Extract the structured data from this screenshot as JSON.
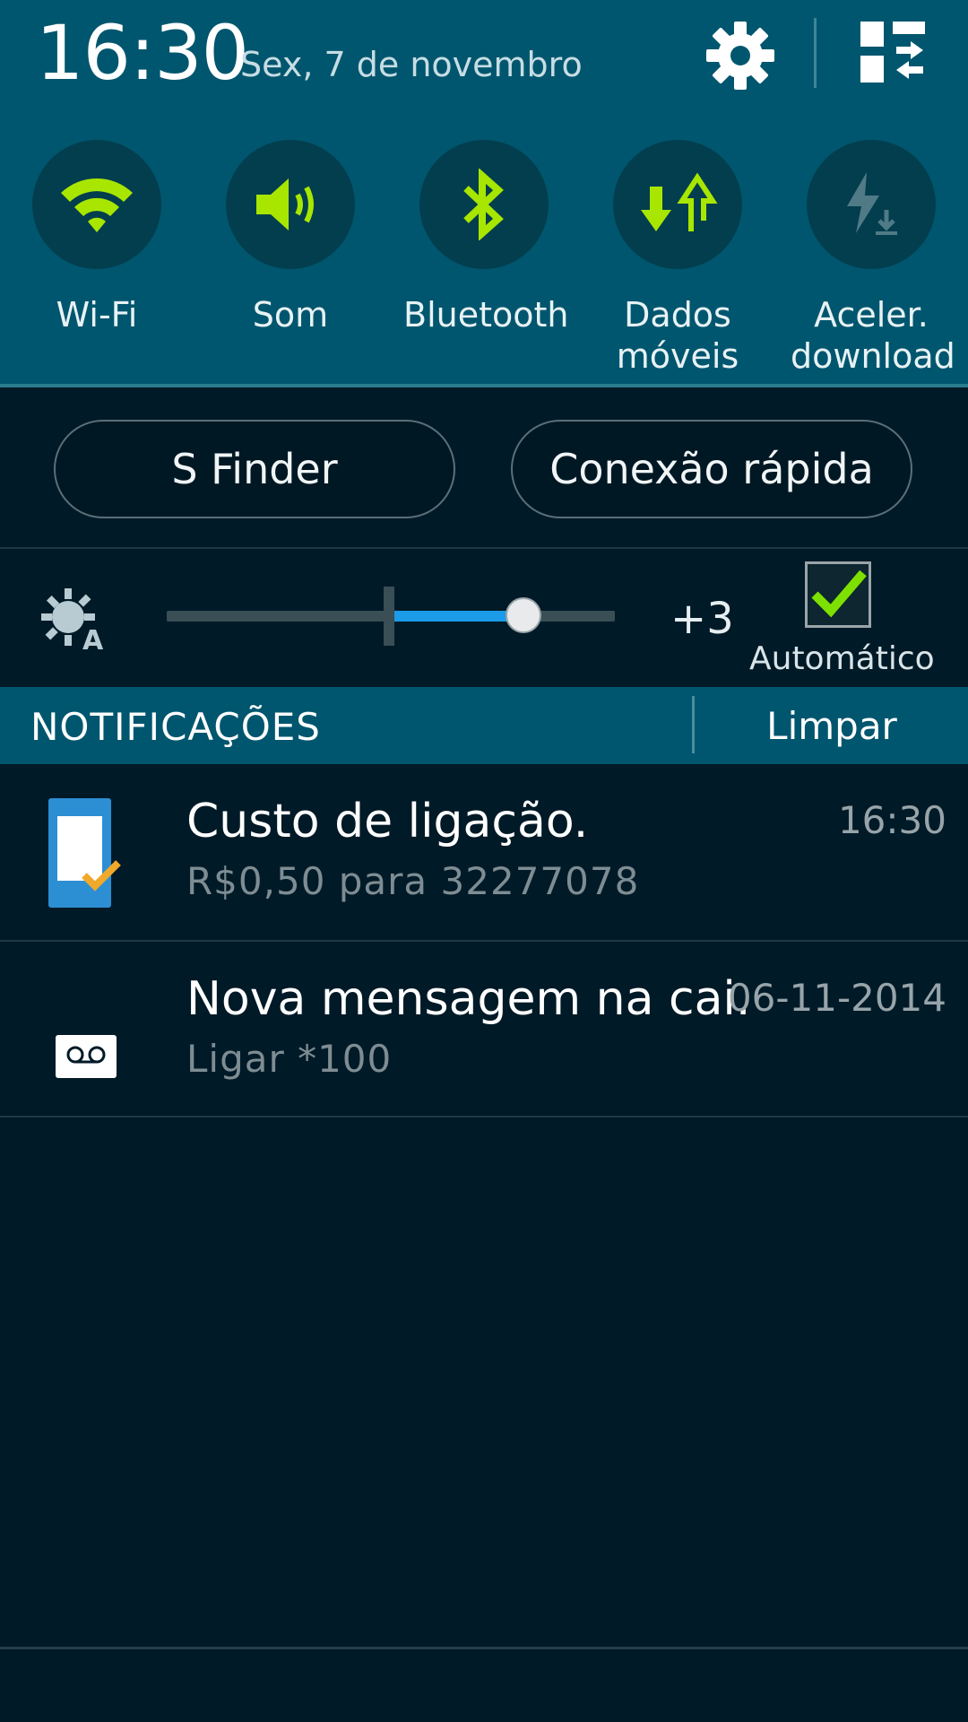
{
  "status": {
    "time": "16:30",
    "date": "Sex, 7 de novembro"
  },
  "toggles": [
    {
      "label": "Wi-Fi",
      "icon": "wifi-icon",
      "active": true
    },
    {
      "label": "Som",
      "icon": "sound-icon",
      "active": true
    },
    {
      "label": "Bluetooth",
      "icon": "bluetooth-icon",
      "active": true
    },
    {
      "label": "Dados móveis",
      "icon": "mobile-data-icon",
      "active": true
    },
    {
      "label": "Aceler. download",
      "icon": "download-booster-icon",
      "active": false
    }
  ],
  "buttons": {
    "s_finder": "S Finder",
    "quick_connect": "Conexão rápida"
  },
  "brightness": {
    "value_label": "+3",
    "auto_label": "Automático",
    "auto_checked": true
  },
  "notifications": {
    "header": "NOTIFICAÇÕES",
    "clear": "Limpar",
    "items": [
      {
        "title": "Custo de ligação.",
        "subtitle": "R$0,50  para  32277078",
        "time": "16:30",
        "icon": "call-cost-icon"
      },
      {
        "title": "Nova mensagem na cai.",
        "subtitle": "Ligar *100",
        "time": "06-11-2014",
        "icon": "voicemail-icon"
      }
    ]
  },
  "colors": {
    "panel": "#00566e",
    "background": "#001a27",
    "accent_green": "#a8e600",
    "slider_blue": "#1b9be8"
  }
}
